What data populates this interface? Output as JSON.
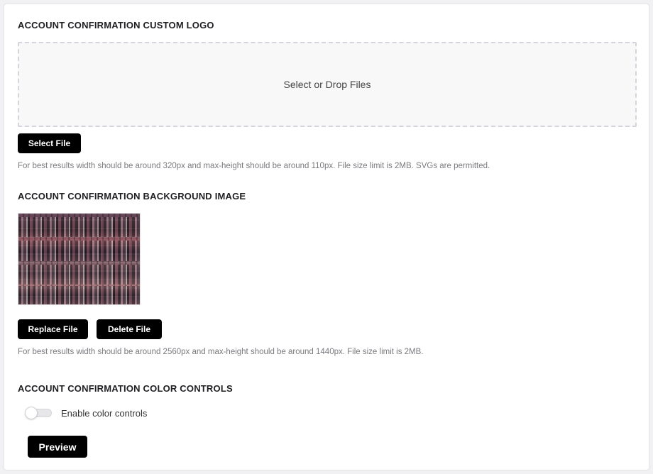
{
  "logo_section": {
    "title": "ACCOUNT CONFIRMATION CUSTOM LOGO",
    "dropzone_text": "Select or Drop Files",
    "select_button": "Select File",
    "hint": "For best results width should be around 320px and max-height should be around 110px. File size limit is 2MB. SVGs are permitted."
  },
  "background_section": {
    "title": "ACCOUNT CONFIRMATION BACKGROUND IMAGE",
    "replace_button": "Replace File",
    "delete_button": "Delete File",
    "hint": "For best results width should be around 2560px and max-height should be around 1440px. File size limit is 2MB."
  },
  "color_section": {
    "title": "ACCOUNT CONFIRMATION COLOR CONTROLS",
    "toggle_label": "Enable color controls",
    "toggle_on": false,
    "preview_button": "Preview"
  },
  "colors": {
    "button_bg": "#000000",
    "button_text": "#ffffff",
    "hint_text": "#7a7a7f",
    "dropzone_border": "#d3d4dd"
  }
}
